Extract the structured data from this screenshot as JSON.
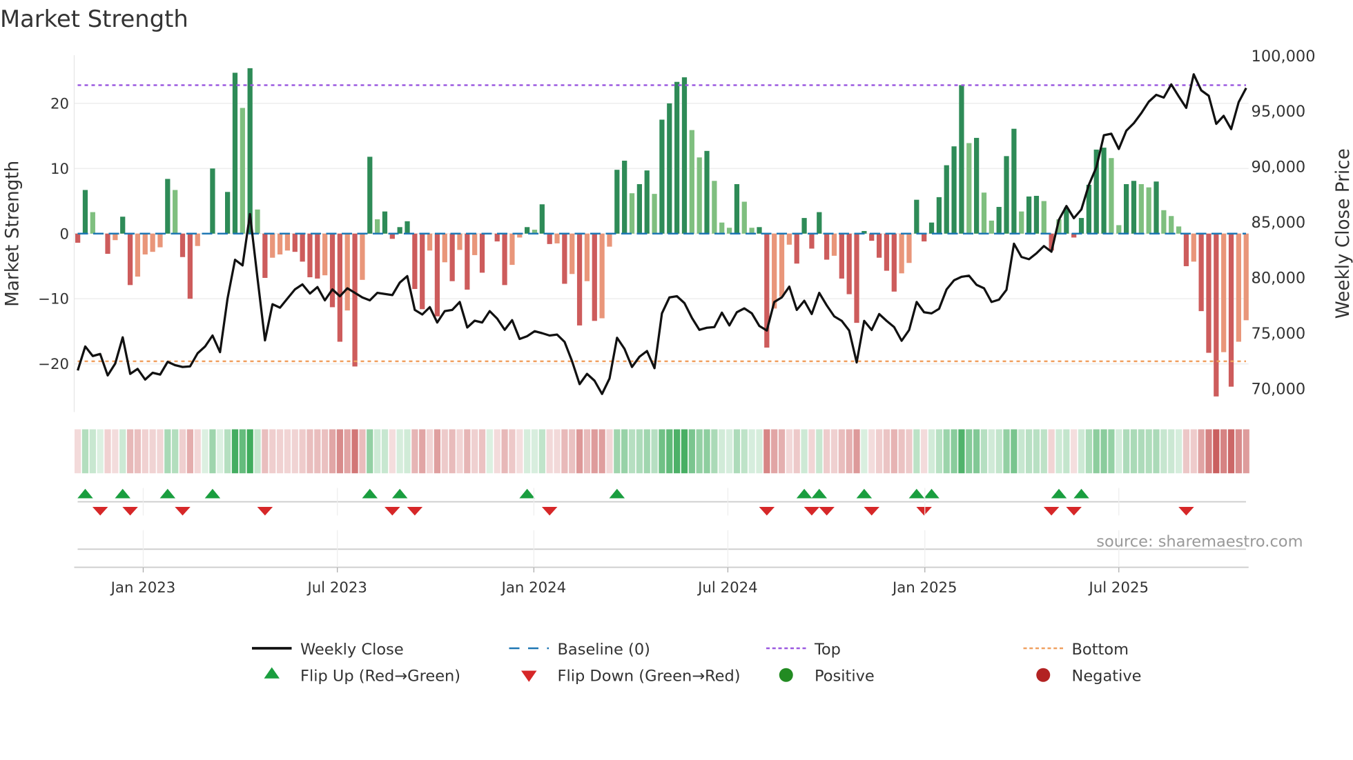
{
  "chart_data": {
    "type": "bar",
    "title": "Market Strength",
    "ylabel": "Market Strength",
    "y2label": "Weekly Close Price",
    "ylim": [
      -27.4,
      27.4
    ],
    "y2lim": [
      67830,
      100000
    ],
    "yticks": [
      20,
      10,
      0,
      -10,
      -20
    ],
    "yticklabels": [
      "20",
      "10",
      "0",
      "−10",
      "−20"
    ],
    "y2ticks": [
      100000,
      95000,
      90000,
      85000,
      80000,
      75000,
      70000
    ],
    "y2ticklabels": [
      "100,000",
      "95,000",
      "90,000",
      "85,000",
      "80,000",
      "75,000",
      "70,000"
    ],
    "top_level": 22.8,
    "bottom_level": -19.6,
    "xticks": [
      {
        "label": "Jan 2023",
        "week": 8.74
      },
      {
        "label": "Jul 2023",
        "week": 34.66
      },
      {
        "label": "Jan 2024",
        "week": 60.9
      },
      {
        "label": "Jul 2024",
        "week": 86.8
      },
      {
        "label": "Jan 2025",
        "week": 113.1
      },
      {
        "label": "Jul 2025",
        "week": 139.0
      }
    ],
    "strength": [
      -1.4,
      6.7,
      3.3,
      0,
      -3.1,
      -1.0,
      2.6,
      -7.9,
      -6.6,
      -3.2,
      -2.8,
      -2.1,
      8.4,
      6.7,
      -3.6,
      -10.0,
      -1.9,
      0,
      10.0,
      0,
      6.4,
      24.7,
      19.3,
      25.4,
      3.7,
      -6.8,
      -3.7,
      -3.2,
      -2.6,
      -2.8,
      -4.3,
      -6.7,
      -6.9,
      -6.4,
      -11.3,
      -16.6,
      -11.8,
      -20.4,
      -7.1,
      11.8,
      2.2,
      3.4,
      -0.8,
      1.0,
      1.9,
      -8.5,
      -11.6,
      -2.6,
      -12.7,
      -4.4,
      -7.3,
      -2.5,
      -8.6,
      -3.3,
      -6.0,
      0,
      -1.2,
      -7.9,
      -4.8,
      -0.6,
      1.0,
      0.6,
      4.5,
      -1.6,
      -1.5,
      -7.7,
      -6.2,
      -14.1,
      -7.3,
      -13.4,
      -13.0,
      -2.0,
      9.8,
      11.2,
      6.2,
      7.6,
      9.7,
      6.1,
      17.5,
      20.0,
      23.3,
      24.0,
      15.9,
      11.7,
      12.7,
      8.1,
      1.7,
      0.9,
      7.6,
      4.9,
      0.9,
      1.0,
      -17.5,
      -11.5,
      -9.7,
      -1.7,
      -4.6,
      2.4,
      -2.3,
      3.3,
      -4.0,
      -3.4,
      -6.9,
      -9.3,
      -13.7,
      0.4,
      -1.1,
      -3.7,
      -5.7,
      -8.9,
      -6.1,
      -4.5,
      5.2,
      -1.2,
      1.7,
      5.6,
      10.5,
      13.4,
      22.8,
      13.9,
      14.7,
      6.3,
      2.0,
      4.1,
      11.9,
      16.1,
      3.4,
      5.7,
      5.8,
      5.0,
      -2.6,
      2.2,
      4.0,
      -0.6,
      2.4,
      7.5,
      12.9,
      13.2,
      11.6,
      1.3,
      7.6,
      8.1,
      7.6,
      7.1,
      8.0,
      3.6,
      2.7,
      1.1,
      -5.0,
      -4.3,
      -11.9,
      -18.3,
      -25.0,
      -18.2,
      -23.5,
      -16.6,
      -13.3
    ],
    "shades": "RGg0RrGRrrrrGgRRr0G0GGgGgRrrrRRRRrRRrRrGgGRGGRRrRrRrRrR0RRrrGgGRrRrRrRrrGGgGGgGGGGggGgggGggGRrrrRGRGRrRRRGRRRRrrGRGGGGGgGggGGGgGGgRgGRGGGGggGGggGgggRrRRRrRrr",
    "close": [
      71582,
      73743,
      72878,
      73064,
      71129,
      72199,
      74566,
      71273,
      71726,
      70759,
      71376,
      71211,
      72364,
      72055,
      71891,
      71952,
      73127,
      73743,
      74731,
      73228,
      78065,
      81563,
      81049,
      85679,
      79917,
      74298,
      77550,
      77241,
      78065,
      78888,
      79341,
      78517,
      79094,
      77900,
      78888,
      78270,
      78991,
      78579,
      78168,
      77900,
      78579,
      78476,
      78373,
      79505,
      80081,
      77035,
      76624,
      77283,
      75904,
      76933,
      77035,
      77756,
      75451,
      76069,
      75904,
      76933,
      76254,
      75245,
      76110,
      74422,
      74669,
      75122,
      74937,
      74731,
      74813,
      74155,
      72405,
      70347,
      71273,
      70656,
      69462,
      70861,
      74525,
      73537,
      71891,
      72817,
      73331,
      71788,
      76727,
      78168,
      78270,
      77653,
      76315,
      75245,
      75430,
      75492,
      76789,
      75636,
      76830,
      77180,
      76727,
      75595,
      75184,
      77756,
      78168,
      79135,
      77035,
      77859,
      76665,
      78579,
      77447,
      76459,
      76048,
      75184,
      72302,
      76048,
      75225,
      76665,
      76048,
      75492,
      74257,
      75225,
      77756,
      76830,
      76727,
      77139,
      78888,
      79711,
      80020,
      80123,
      79299,
      78991,
      77756,
      77962,
      78847,
      83004,
      81810,
      81604,
      82139,
      82798,
      82283,
      85165,
      86399,
      85309,
      86091,
      88314,
      89898,
      92779,
      92923,
      91544,
      93191,
      93870,
      94776,
      95805,
      96422,
      96175,
      97369,
      96278,
      95249,
      98274,
      96833,
      96339,
      93808,
      94529,
      93335,
      95763,
      97039
    ],
    "flips_up": [
      1,
      6,
      12,
      18,
      39,
      43,
      60,
      72,
      97,
      99,
      105,
      112,
      114,
      131,
      134
    ],
    "flips_down": [
      3,
      7,
      14,
      25,
      42,
      45,
      63,
      92,
      98,
      100,
      106,
      113,
      130,
      133,
      148
    ],
    "legend": [
      {
        "label": "Weekly Close",
        "symbol": "line"
      },
      {
        "label": "Baseline (0)",
        "symbol": "dash"
      },
      {
        "label": "Top",
        "symbol": "dot-purple"
      },
      {
        "label": "Bottom",
        "symbol": "dot-orange"
      },
      {
        "label": "Flip Up (Red→Green)",
        "symbol": "triangle-up"
      },
      {
        "label": "Flip Down (Green→Red)",
        "symbol": "triangle-down"
      },
      {
        "label": "Positive",
        "symbol": "circle-green"
      },
      {
        "label": "Negative",
        "symbol": "circle-red"
      }
    ],
    "legend_placement": "bottom",
    "source": "source: sharemaestro.com",
    "colors": {
      "strong_green": "#2e8b57",
      "weak_green": "#7fbf7f",
      "strong_red": "#cd5c5c",
      "weak_red": "#e9967a",
      "baseline": "#1f77b4",
      "top": "#9b59e0",
      "bottom": "#f0a060",
      "flip_up": "#1a9e3f",
      "flip_down": "#d62728",
      "positive": "#228b22",
      "negative": "#b22222",
      "close": "#111111"
    }
  }
}
